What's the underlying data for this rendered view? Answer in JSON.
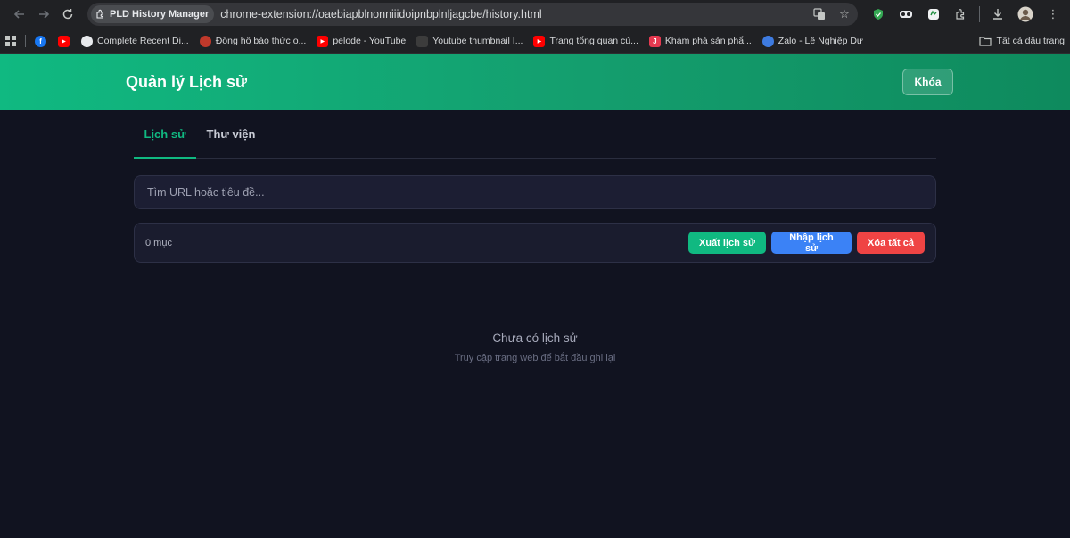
{
  "browser": {
    "extension_chip": "PLD History Manager",
    "url": "chrome-extension://oaebiapblnonniiidoipnbplnljagcbe/history.html"
  },
  "bookmarks": {
    "items": [
      {
        "label": "",
        "icon": "facebook-icon",
        "color": "#1877f2"
      },
      {
        "label": "",
        "icon": "youtube-icon",
        "color": "#ff0000"
      },
      {
        "label": "Complete Recent Di...",
        "icon": "github-icon",
        "color": "#e8eaed"
      },
      {
        "label": "Đồng hồ báo thức o...",
        "icon": "alarm-icon",
        "color": "#c0392b"
      },
      {
        "label": "pelode - YouTube",
        "icon": "youtube-icon",
        "color": "#ff0000"
      },
      {
        "label": "Youtube thumbnail I...",
        "icon": "blank-page-icon",
        "color": "#3c3c3c"
      },
      {
        "label": "Trang tổng quan củ...",
        "icon": "youtube-icon",
        "color": "#ff0000"
      },
      {
        "label": "Khám phá sản phẩ...",
        "icon": "j-icon",
        "color": "#e53950"
      },
      {
        "label": "Zalo - Lê Nghiệp Dư",
        "icon": "zalo-icon",
        "color": "#3e7be0"
      }
    ],
    "all_bookmarks": "Tất cả dấu trang"
  },
  "header": {
    "title": "Quản lý Lịch sử",
    "lock_label": "Khóa"
  },
  "tabs": [
    {
      "label": "Lịch sử",
      "active": true
    },
    {
      "label": "Thư viện",
      "active": false
    }
  ],
  "search": {
    "placeholder": "Tìm URL hoặc tiêu đề..."
  },
  "toolbar": {
    "count": "0 mục",
    "export_label": "Xuất lịch sử",
    "import_label": "Nhập lịch sử",
    "clear_label": "Xóa tất cả"
  },
  "empty_state": {
    "title": "Chưa có lịch sử",
    "subtitle": "Truy cập trang web để bắt đầu ghi lại"
  },
  "colors": {
    "accent": "#10b981",
    "blue": "#3b82f6",
    "red": "#ef4444",
    "background": "#111320"
  }
}
